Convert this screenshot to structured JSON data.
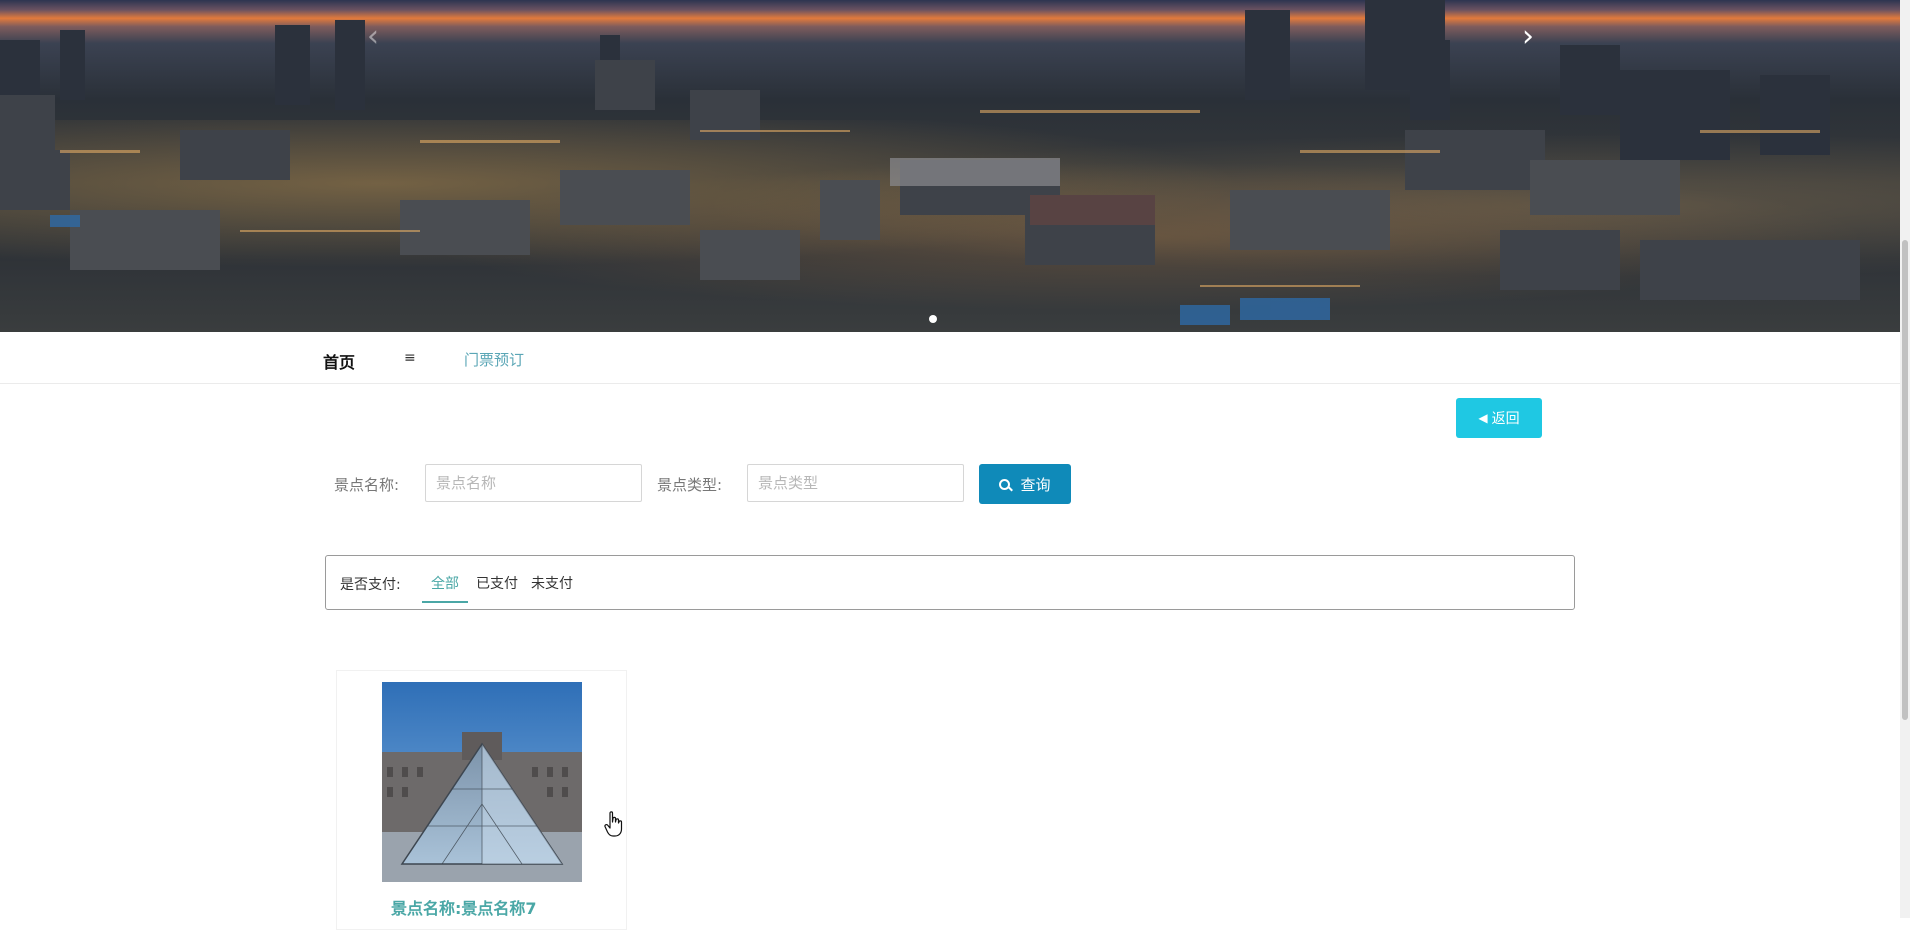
{
  "banner": {
    "prev_icon": "chevron-left-icon",
    "next_icon": "chevron-right-icon",
    "prev_glyph": "‹",
    "next_glyph": "›",
    "slide_count": 1,
    "active_slide": 1
  },
  "nav": {
    "home": "首页",
    "menu_glyph": "≡",
    "tickets": "门票预订"
  },
  "actions": {
    "return_label": "返回",
    "return_icon": "caret-left-icon"
  },
  "search": {
    "name_label": "景点名称:",
    "name_placeholder": "景点名称",
    "name_value": "",
    "type_label": "景点类型:",
    "type_placeholder": "景点类型",
    "type_value": "",
    "submit_label": "查询",
    "submit_icon": "search-icon"
  },
  "filter": {
    "label": "是否支付:",
    "options": [
      "全部",
      "已支付",
      "未支付"
    ],
    "selected": "全部"
  },
  "cards": [
    {
      "title": "景点名称:景点名称7",
      "image": "glass-pyramid-photo"
    }
  ],
  "colors": {
    "accent_teal": "#4aa7a6",
    "return_button": "#1fc8e3",
    "search_button": "#0f8ab9"
  }
}
